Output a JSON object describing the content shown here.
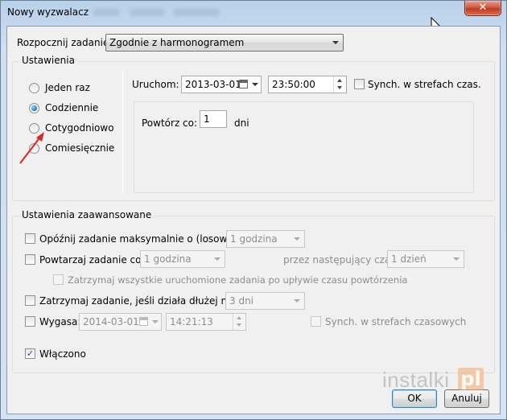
{
  "window": {
    "title": "Nowy wyzwalacz",
    "close_glyph": "✕",
    "icons": {
      "close": "close-icon",
      "cursor": "mouse-cursor-icon"
    }
  },
  "start_task": {
    "label": "Rozpocznij zadanie:",
    "value": "Zgodnie z harmonogramem"
  },
  "settings": {
    "group_title": "Ustawienia",
    "radios": [
      {
        "label": "Jeden raz",
        "checked": false
      },
      {
        "label": "Codziennie",
        "checked": true
      },
      {
        "label": "Cotygodniowo",
        "checked": false
      },
      {
        "label": "Comiesięcznie",
        "checked": false
      }
    ],
    "start_label": "Uruchom:",
    "start_date": "2013-03-01",
    "start_time": "23:50:00",
    "sync_label": "Synch. w strefach czas.",
    "sync_checked": false,
    "repeat_label": "Powtórz co:",
    "repeat_value": "1",
    "repeat_unit": "dni"
  },
  "advanced": {
    "group_title": "Ustawienia zaawansowane",
    "delay_label": "Opóźnij zadanie maksymalnie o (losowe):",
    "delay_value": "1 godzina",
    "repeat_label": "Powtarzaj zadanie co:",
    "repeat_value": "1 godzina",
    "for_duration_label": "przez następujący czas:",
    "for_duration_value": "1 dzień",
    "stop_all_label": "Zatrzymaj wszystkie uruchomione zadania po upływie czasu powtórzenia",
    "stop_if_label": "Zatrzymaj zadanie, jeśli działa dłużej niż:",
    "stop_if_value": "3 dni",
    "expire_label": "Wygasa:",
    "expire_date": "2014-03-01",
    "expire_time": "14:21:13",
    "expire_sync_label": "Synch. w strefach czasowych",
    "enabled_label": "Włączono",
    "enabled_checked": true,
    "check_glyph": "✓"
  },
  "buttons": {
    "ok": "OK",
    "cancel": "Anuluj"
  },
  "watermark": {
    "text": "instalki",
    "badge": "pl",
    "accent": "#f6aa6e"
  },
  "annotation": {
    "arrow_color": "#d8262b",
    "icon": "red-arrow-icon"
  }
}
